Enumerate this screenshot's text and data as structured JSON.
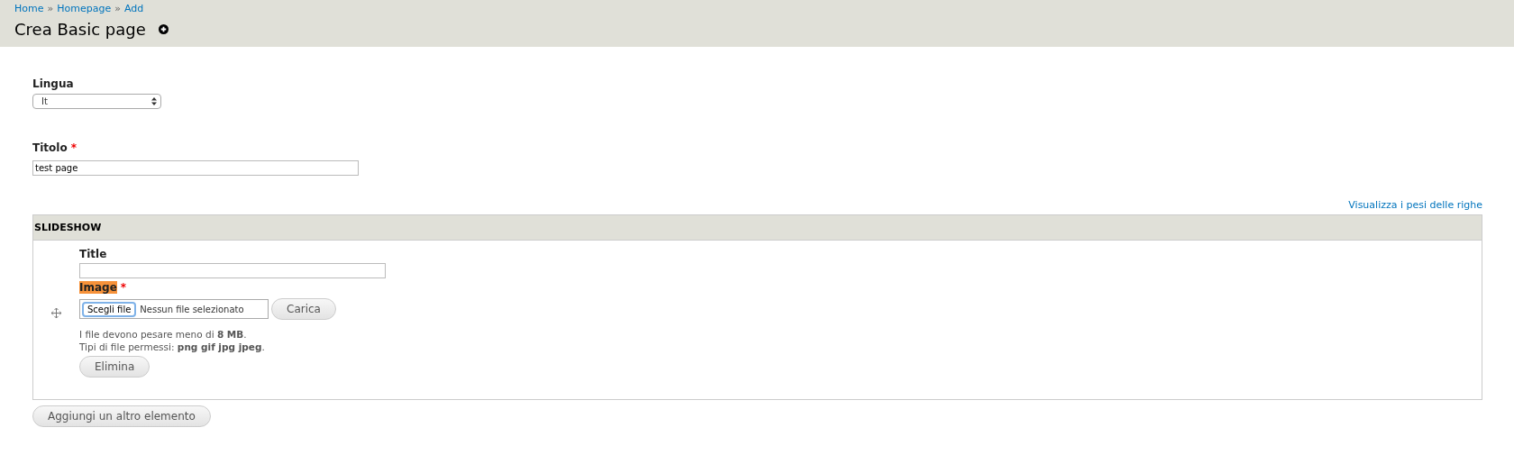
{
  "breadcrumb": [
    "Home",
    "Homepage",
    "Add"
  ],
  "breadcrumb_separator": "»",
  "page_title": "Crea Basic page",
  "required_mark": "*",
  "fields": [
    {
      "label": "Lingua",
      "kind": "select",
      "value": "It",
      "required": false
    },
    {
      "label": "Titolo",
      "kind": "text",
      "value": "test page",
      "required": true
    }
  ],
  "row_weights_link": "Visualizza i pesi delle righe",
  "table": {
    "heading": "SLIDESHOW",
    "rows": [
      {
        "title_label": "Title",
        "title_value": "",
        "image_label": "Image",
        "image_required": true,
        "image_error": true,
        "choose_button": "Scegli file",
        "file_status": "Nessun file selezionato",
        "upload_button": "Carica",
        "help": [
          "I file devono pesare meno di **8 MB**.",
          "Tipi di file permessi: **png gif jpg jpeg**."
        ],
        "remove_button": "Elimina"
      }
    ]
  },
  "add_button": "Aggiungi un altro elemento"
}
